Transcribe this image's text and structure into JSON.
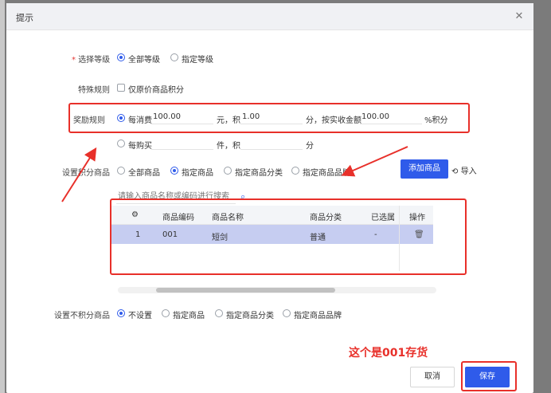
{
  "dialog": {
    "title": "提示",
    "close_icon": "close-icon"
  },
  "level": {
    "label": "选择等级",
    "options": [
      "全部等级",
      "指定等级"
    ],
    "selected": 0
  },
  "special_rule": {
    "label": "特殊规则",
    "checkbox_label": "仅原价商品积分",
    "checked": false
  },
  "reward_rule": {
    "label": "奖励规则",
    "per_spend_label": "每消费",
    "per_spend_value": "100.00",
    "yuan_text": "元，积",
    "points_value": "1.00",
    "points_text": "分，按实收金额",
    "actual_amount_value": "100.00",
    "percent_text": "%积分",
    "per_buy_label": "每购买",
    "per_buy_value": "",
    "items_text": "件，积",
    "items_points_value": "",
    "score_text": "分",
    "selected": 0
  },
  "points_goods": {
    "label": "设置积分商品",
    "options": [
      "全部商品",
      "指定商品",
      "指定商品分类",
      "指定商品品牌"
    ],
    "selected": 1,
    "add_button": "添加商品",
    "import_button": "导入",
    "search_placeholder": "请输入商品名称或编码进行搜索"
  },
  "table": {
    "columns": [
      "商品编码",
      "商品名称",
      "商品分类",
      "已选属性",
      "操作"
    ],
    "rows": [
      {
        "index": "1",
        "code": "001",
        "name": "短剑",
        "category": "普通",
        "attrs": "-"
      }
    ]
  },
  "no_points_goods": {
    "label": "设置不积分商品",
    "options": [
      "不设置",
      "指定商品",
      "指定商品分类",
      "指定商品品牌"
    ],
    "selected": 0
  },
  "annotation": "这个是001存货",
  "footer": {
    "cancel": "取消",
    "save": "保存"
  },
  "colors": {
    "primary": "#2f5bea",
    "annotation_red": "#e8302a",
    "selected_row": "#c6cdf1"
  }
}
